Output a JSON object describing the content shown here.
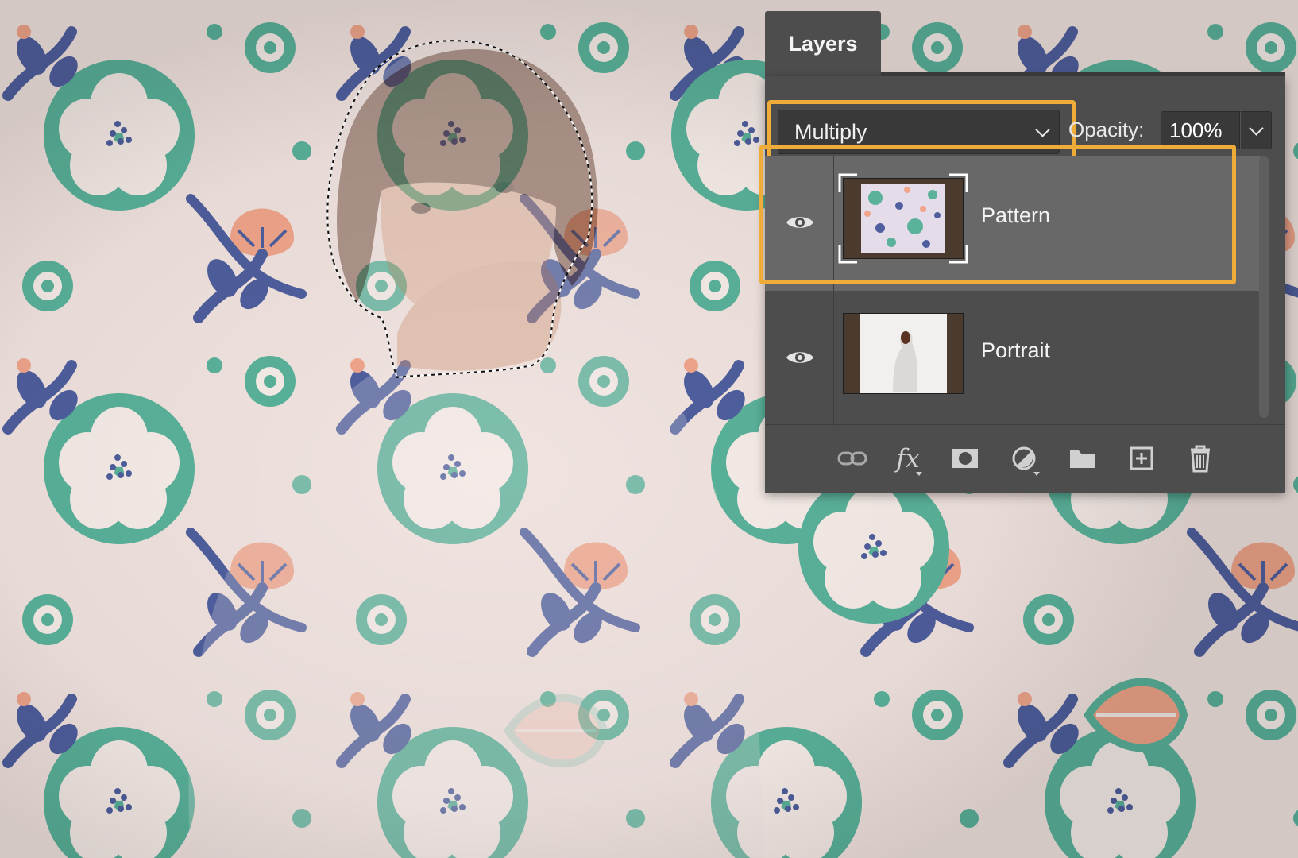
{
  "panel": {
    "tab_label": "Layers",
    "blend_mode": "Multiply",
    "opacity_label": "Opacity:",
    "opacity_value": "100%"
  },
  "layers": [
    {
      "name": "Pattern",
      "selected": true,
      "visible": true,
      "thumbnail": "floral-pattern"
    },
    {
      "name": "Portrait",
      "selected": false,
      "visible": true,
      "thumbnail": "person-in-hoodie-photo"
    }
  ],
  "toolbar_icons": [
    "link-icon",
    "fx-icon",
    "mask-icon",
    "adjustment-icon",
    "folder-icon",
    "new-layer-icon",
    "trash-icon"
  ],
  "colors": {
    "highlight": "#f0ac38",
    "panel_bg": "#4d4d4d",
    "selected_row": "#686868",
    "pattern_green": "#5ab29a",
    "pattern_blue": "#4f5f9e",
    "pattern_salmon": "#f0a58b",
    "pattern_bg": "#f1e3df"
  }
}
